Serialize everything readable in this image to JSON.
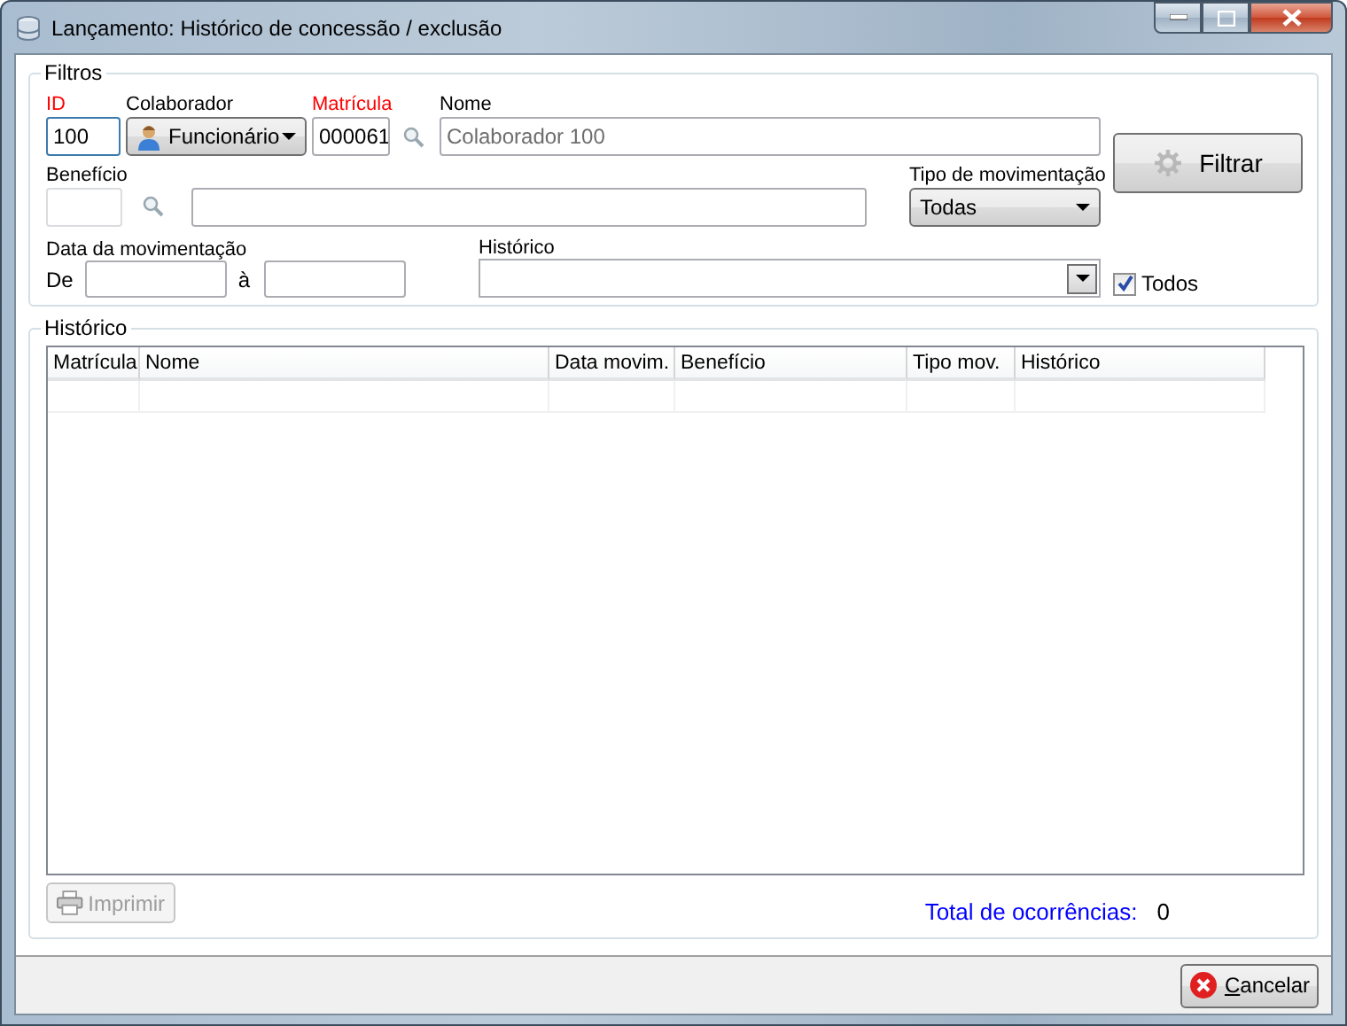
{
  "window": {
    "title": "Lançamento: Histórico de concessão / exclusão"
  },
  "filters": {
    "title": "Filtros",
    "id": {
      "label": "ID",
      "required": true,
      "value": "100"
    },
    "colaborador": {
      "label": "Colaborador",
      "value": "Funcionário"
    },
    "matricula": {
      "label": "Matrícula",
      "required": true,
      "value": "000061"
    },
    "nome": {
      "label": "Nome",
      "value": "Colaborador 100",
      "disabled": true
    },
    "beneficio": {
      "label": "Benefício",
      "disabled": true
    },
    "tipo": {
      "label": "Tipo de movimentação",
      "value": "Todas"
    },
    "data": {
      "label": "Data da movimentação",
      "from_label": "De",
      "to_label": "à"
    },
    "historico": {
      "label": "Histórico"
    },
    "todos": {
      "label": "Todos",
      "checked": true
    },
    "filter_button": {
      "label": "Filtrar"
    }
  },
  "history": {
    "title": "Histórico",
    "table": {
      "columns": [
        {
          "label": "Matrícula"
        },
        {
          "label": "Nome"
        },
        {
          "label": "Data movim."
        },
        {
          "label": "Benefício"
        },
        {
          "label": "Tipo mov."
        },
        {
          "label": "Histórico"
        }
      ]
    },
    "print_button": {
      "label": "Imprimir",
      "disabled": true
    },
    "total": {
      "label": "Total de ocorrências:",
      "value": "0"
    }
  },
  "cancel_button": {
    "label": "Cancelar"
  }
}
